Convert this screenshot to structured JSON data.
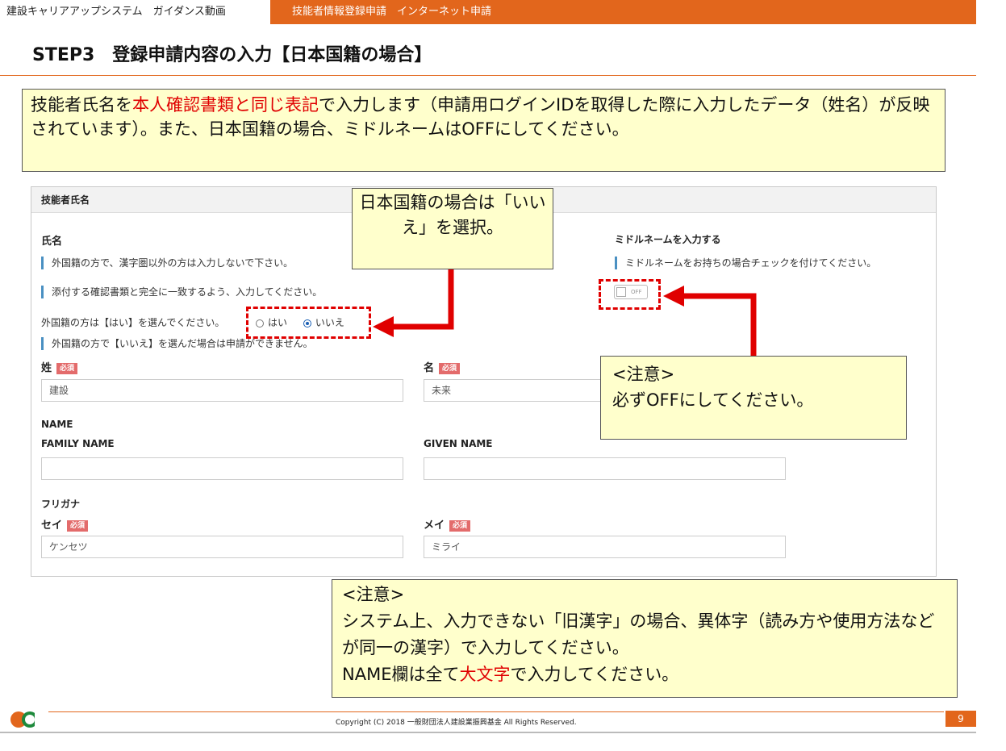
{
  "header": {
    "left_tab": "建設キャリアアップシステム　ガイダンス動画",
    "right_title": "技能者情報登録申請　インターネット申請"
  },
  "headline": "STEP3　登録申請内容の入力【日本国籍の場合】",
  "callouts": {
    "main": {
      "part1": "技能者氏名を",
      "part2_red": "本人確認書類と同じ表記",
      "part3": "で入力します（申請用ログインIDを取得した際に入力したデータ（姓名）が反映されています）。また、日本国籍の場合、ミドルネームはOFFにしてください。"
    },
    "kokuseki": "日本国籍の場合は「いいえ」を選択。",
    "off_line1": "<注意>",
    "off_line2": "必ずOFFにしてください。",
    "kanji_line1": "<注意>",
    "kanji_line2": "システム上、入力できない「旧漢字」の場合、異体字（読み方や使用方法などが同一の漢字）で入力してください。",
    "kanji_line3_a": "NAME欄は全て",
    "kanji_line3_red": "大文字",
    "kanji_line3_b": "で入力してください。"
  },
  "form": {
    "section_title": "技能者氏名",
    "name_label": "氏名",
    "note1": "外国籍の方で、漢字圏以外の方は入力しないで下さい。",
    "note2": "添付する確認書類と完全に一致するよう、入力してください。",
    "foreign_question": "外国籍の方は【はい】を選んでください。",
    "radio_yes": "はい",
    "radio_no": "いいえ",
    "radio_selected": "いいえ",
    "note3": "外国籍の方で【いいえ】を選んだ場合は申請ができません。",
    "required_badge": "必須",
    "sei_label": "姓",
    "sei_value": "建設",
    "mei_label": "名",
    "mei_value": "未来",
    "name_heading": "NAME",
    "family_name_label": "FAMILY NAME",
    "family_name_value": "",
    "given_name_label": "GIVEN NAME",
    "given_name_value": "",
    "furigana_heading": "フリガナ",
    "sei_kana_label": "セイ",
    "sei_kana_value": "ケンセツ",
    "mei_kana_label": "メイ",
    "mei_kana_value": "ミライ",
    "middle_name_label": "ミドルネームを入力する",
    "middle_name_note": "ミドルネームをお持ちの場合チェックを付けてください。",
    "toggle_text": "OFF"
  },
  "footer": {
    "copyright": "Copyright (C) 2018 一般財団法人建設業振興基金 All Rights Reserved.",
    "page": "9"
  },
  "colors": {
    "accent": "#e2661c",
    "callout_bg": "#ffffcc",
    "highlight_red": "#e00000",
    "note_bar": "#4a90c2",
    "badge": "#e36b6b"
  }
}
